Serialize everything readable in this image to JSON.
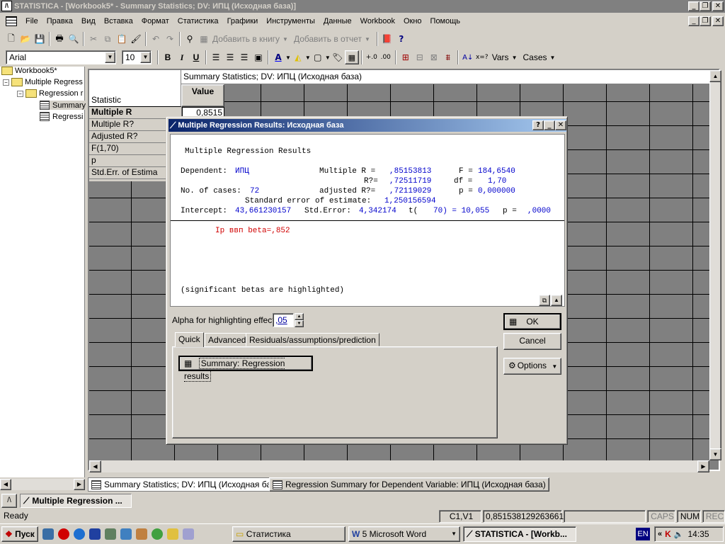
{
  "app": {
    "title": "STATISTICA - [Workbook5* - Summary Statistics; DV: ИПЦ (Исходная база)]"
  },
  "menu": [
    "File",
    "Правка",
    "Вид",
    "Вставка",
    "Формат",
    "Статистика",
    "Графики",
    "Инструменты",
    "Данные",
    "Workbook",
    "Окно",
    "Помощь"
  ],
  "toolbar": {
    "add_to_book": "Добавить в книгу",
    "add_to_report": "Добавить в отчет",
    "font_name": "Arial",
    "font_size": "10",
    "bold": "B",
    "italic": "I",
    "underline": "U",
    "vars": "Vars",
    "cases": "Cases"
  },
  "tree": {
    "root": "Workbook5*",
    "n1": "Multiple Regress",
    "n2": "Regression r",
    "n3": "Summary",
    "n4": "Regressi"
  },
  "sheet": {
    "header": "Summary Statistics; DV: ИПЦ (Исходная база)",
    "col_header": "Value",
    "row_header": "Statistic",
    "rows": [
      "Multiple R",
      "Multiple R?",
      "Adjusted R?",
      "F(1,70)",
      "p",
      "Std.Err. of Estima"
    ],
    "first_value": "0,8515"
  },
  "dialog": {
    "title": "Multiple Regression Results: Исходная база",
    "heading": "Multiple Regression Results",
    "l1a": "Dependent:",
    "l1b": "ИПЦ",
    "l1c": "Multiple R =",
    "l1d": ",85153813",
    "l1e": "F =",
    "l1f": "184,6540",
    "l2a": "R?=",
    "l2b": ",72511719",
    "l2c": "df =",
    "l2d": "1,70",
    "l3a": "No. of cases:",
    "l3b": "72",
    "l3c": "adjusted R?=",
    "l3d": ",72119029",
    "l3e": "p =",
    "l3f": "0,000000",
    "l4a": "Standard error of estimate:",
    "l4b": "1,250156594",
    "l5a": "Intercept:",
    "l5b": "43,661230157",
    "l5c": "Std.Error:",
    "l5d": "4,342174",
    "l5e": "t(",
    "l5f": "70) = 10,055",
    "l5g": "p =",
    "l5h": ",0000",
    "beta": "Ip ввп beta=,852",
    "footnote": "(significant betas are highlighted)",
    "alpha_label": "Alpha for highlighting effects:",
    "alpha_value": ",05",
    "ok": "OK",
    "cancel": "Cancel",
    "options": "Options",
    "tabs": [
      "Quick",
      "Advanced",
      "Residuals/assumptions/prediction"
    ],
    "summary_button": "Summary:  Regression results"
  },
  "sheet_tabs": [
    "Summary Statistics; DV: ИПЦ (Исходная база)",
    "Regression Summary for Dependent Variable: ИПЦ (Исходная база)"
  ],
  "mdi": {
    "title": "Multiple Regression ..."
  },
  "status": {
    "ready": "Ready",
    "cell": "C1,V1",
    "value": "0,851538129263661",
    "caps": "CAPS",
    "num": "NUM",
    "rec": "REC"
  },
  "taskbar": {
    "start": "Пуск",
    "tasks": [
      "Статистика",
      "5 Microsoft Word",
      "STATISTICA - [Workb..."
    ],
    "lang": "EN",
    "time": "14:35"
  }
}
